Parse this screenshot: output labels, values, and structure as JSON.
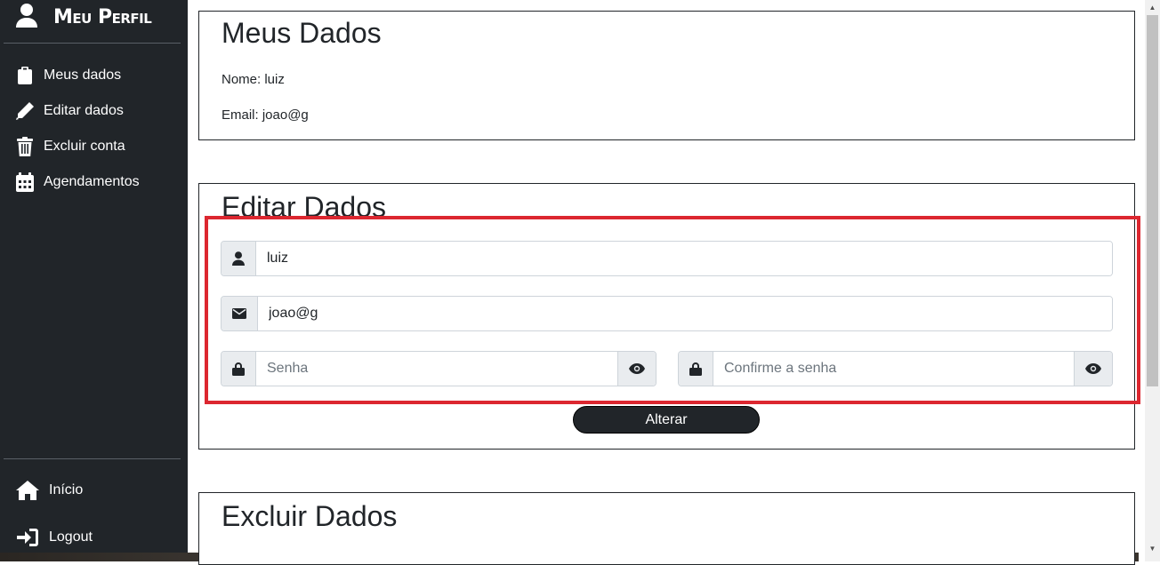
{
  "sidebar": {
    "brand": "Meu Perfil",
    "items": [
      {
        "label": "Meus dados",
        "icon": "clipboard-icon"
      },
      {
        "label": "Editar dados",
        "icon": "pencil-icon"
      },
      {
        "label": "Excluir conta",
        "icon": "trash-icon"
      },
      {
        "label": "Agendamentos",
        "icon": "calendar-icon"
      }
    ],
    "bottom_items": [
      {
        "label": "Início",
        "icon": "home-icon"
      },
      {
        "label": "Logout",
        "icon": "sign-in-icon"
      }
    ]
  },
  "meus_dados": {
    "title": "Meus Dados",
    "nome": "Nome: luiz",
    "email": "Email: joao@g"
  },
  "editar_dados": {
    "title": "Editar Dados",
    "name_value": "luiz",
    "email_value": "joao@g",
    "senha_placeholder": "Senha",
    "confirm_placeholder": "Confirme a senha",
    "submit_label": "Alterar"
  },
  "excluir_dados": {
    "title": "Excluir Dados"
  },
  "colors": {
    "sidebar_bg": "#212529",
    "highlight": "#dc2730",
    "addon_bg": "#e9ecef"
  }
}
